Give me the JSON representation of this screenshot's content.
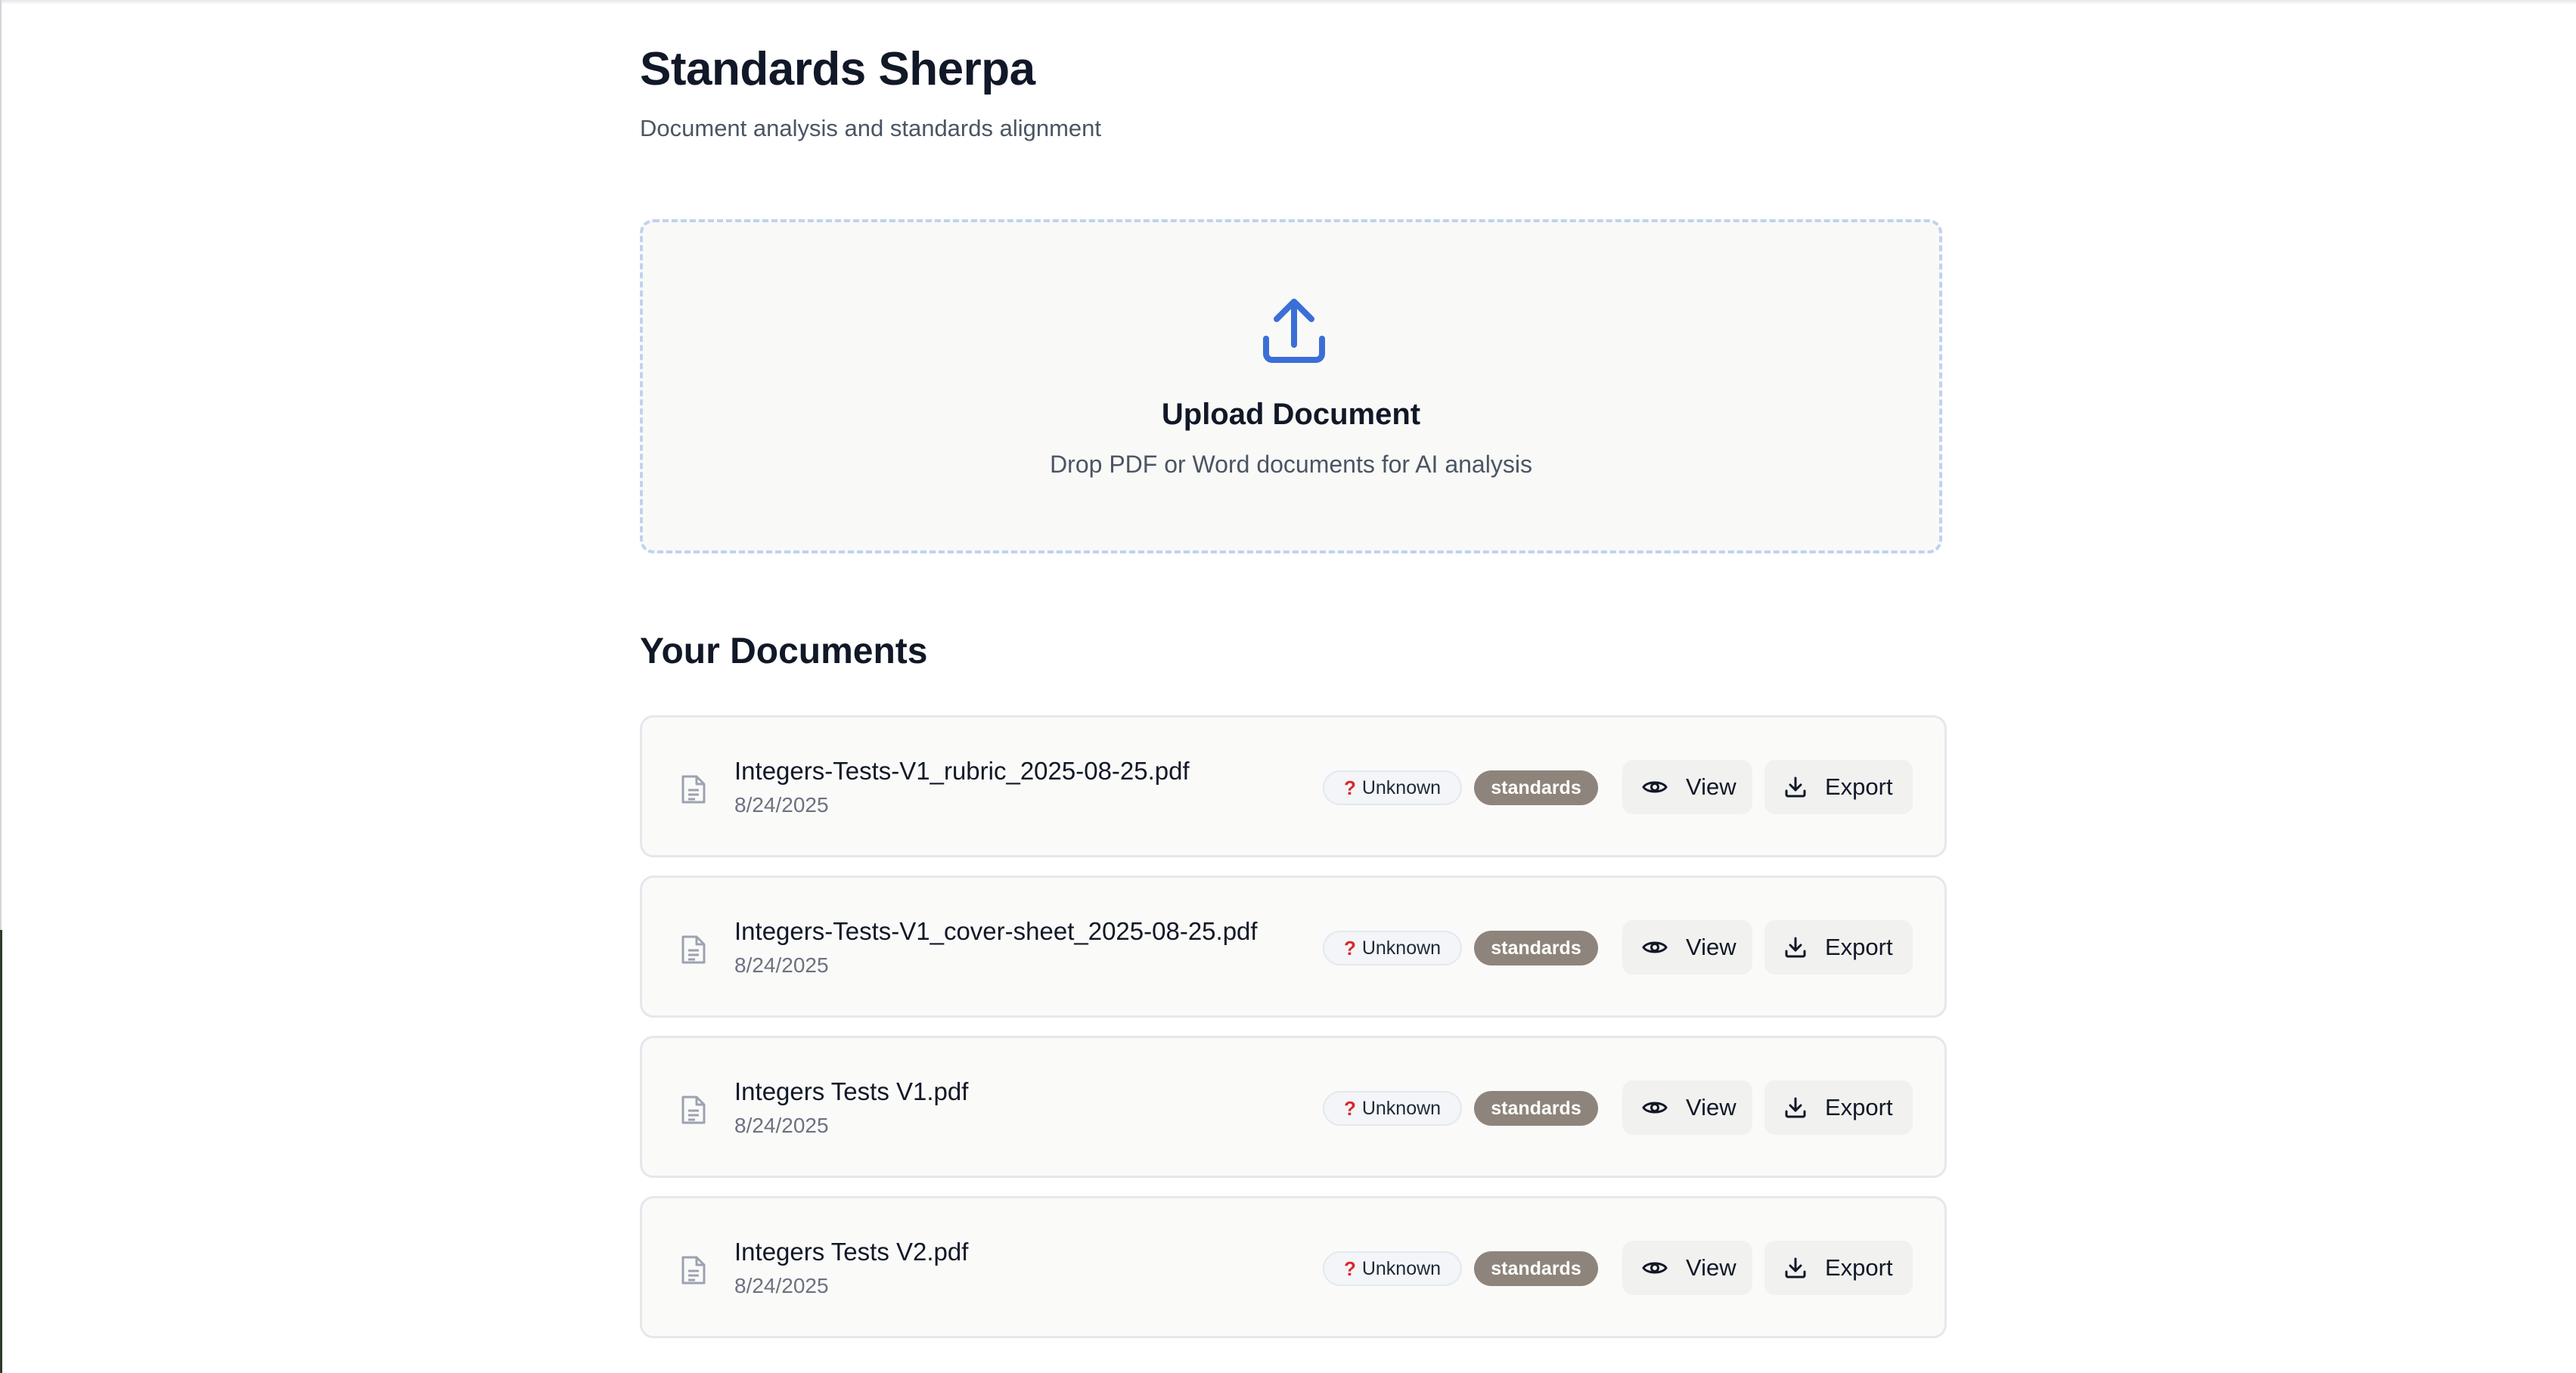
{
  "header": {
    "title": "Standards Sherpa",
    "subtitle": "Document analysis and standards alignment"
  },
  "upload": {
    "icon": "upload-icon",
    "title": "Upload Document",
    "hint": "Drop PDF or Word documents for AI analysis"
  },
  "documents": {
    "section_title": "Your Documents",
    "items": [
      {
        "name": "Integers-Tests-V1_rubric_2025-08-25.pdf",
        "date": "8/24/2025",
        "status_icon": "?",
        "status": "Unknown",
        "tag": "standards",
        "view_label": "View",
        "export_label": "Export"
      },
      {
        "name": "Integers-Tests-V1_cover-sheet_2025-08-25.pdf",
        "date": "8/24/2025",
        "status_icon": "?",
        "status": "Unknown",
        "tag": "standards",
        "view_label": "View",
        "export_label": "Export"
      },
      {
        "name": "Integers Tests V1.pdf",
        "date": "8/24/2025",
        "status_icon": "?",
        "status": "Unknown",
        "tag": "standards",
        "view_label": "View",
        "export_label": "Export"
      },
      {
        "name": "Integers Tests V2.pdf",
        "date": "8/24/2025",
        "status_icon": "?",
        "status": "Unknown",
        "tag": "standards",
        "view_label": "View",
        "export_label": "Export"
      }
    ]
  },
  "colors": {
    "accent": "#3b6fd8",
    "status_icon": "#dc2626",
    "tag_background": "#8e847b"
  }
}
